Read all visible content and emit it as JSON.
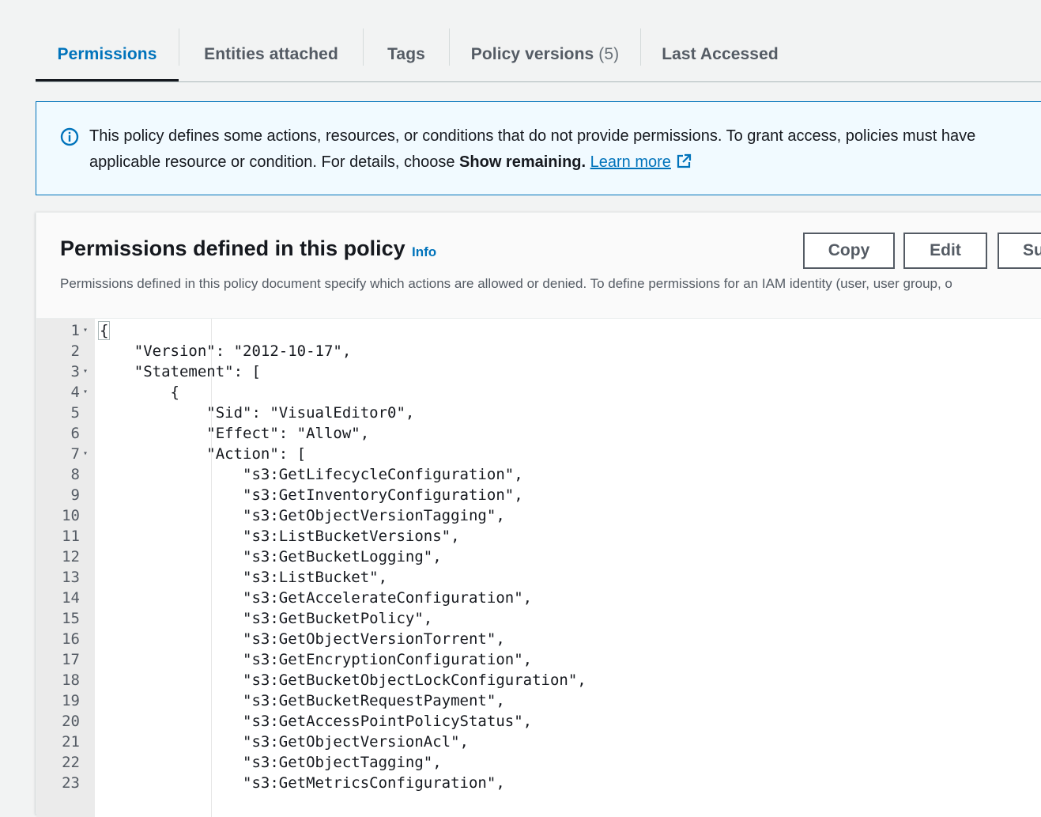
{
  "tabs": [
    {
      "label": "Permissions",
      "count": "",
      "active": true
    },
    {
      "label": "Entities attached",
      "count": "",
      "active": false
    },
    {
      "label": "Tags",
      "count": "",
      "active": false
    },
    {
      "label": "Policy versions",
      "count": "(5)",
      "active": false
    },
    {
      "label": "Last Accessed",
      "count": "",
      "active": false
    }
  ],
  "alert": {
    "icon": "info-icon",
    "text_part1": "This policy defines some actions, resources, or conditions that do not provide permissions. To grant access, policies must have",
    "text_part2": "applicable resource or condition. For details, choose ",
    "bold": "Show remaining.",
    "link": "Learn more",
    "link_icon": "external-link-icon"
  },
  "panel": {
    "title": "Permissions defined in this policy",
    "info": "Info",
    "buttons": {
      "copy": "Copy",
      "edit": "Edit",
      "third": "Su"
    },
    "description": "Permissions defined in this policy document specify which actions are allowed or denied. To define permissions for an IAM identity (user, user group, o"
  },
  "editor": {
    "lines": [
      {
        "n": "1",
        "fold": true,
        "text": "{"
      },
      {
        "n": "2",
        "fold": false,
        "text": "    \"Version\": \"2012-10-17\","
      },
      {
        "n": "3",
        "fold": true,
        "text": "    \"Statement\": ["
      },
      {
        "n": "4",
        "fold": true,
        "text": "        {"
      },
      {
        "n": "5",
        "fold": false,
        "text": "            \"Sid\": \"VisualEditor0\","
      },
      {
        "n": "6",
        "fold": false,
        "text": "            \"Effect\": \"Allow\","
      },
      {
        "n": "7",
        "fold": true,
        "text": "            \"Action\": ["
      },
      {
        "n": "8",
        "fold": false,
        "text": "                \"s3:GetLifecycleConfiguration\","
      },
      {
        "n": "9",
        "fold": false,
        "text": "                \"s3:GetInventoryConfiguration\","
      },
      {
        "n": "10",
        "fold": false,
        "text": "                \"s3:GetObjectVersionTagging\","
      },
      {
        "n": "11",
        "fold": false,
        "text": "                \"s3:ListBucketVersions\","
      },
      {
        "n": "12",
        "fold": false,
        "text": "                \"s3:GetBucketLogging\","
      },
      {
        "n": "13",
        "fold": false,
        "text": "                \"s3:ListBucket\","
      },
      {
        "n": "14",
        "fold": false,
        "text": "                \"s3:GetAccelerateConfiguration\","
      },
      {
        "n": "15",
        "fold": false,
        "text": "                \"s3:GetBucketPolicy\","
      },
      {
        "n": "16",
        "fold": false,
        "text": "                \"s3:GetObjectVersionTorrent\","
      },
      {
        "n": "17",
        "fold": false,
        "text": "                \"s3:GetEncryptionConfiguration\","
      },
      {
        "n": "18",
        "fold": false,
        "text": "                \"s3:GetBucketObjectLockConfiguration\","
      },
      {
        "n": "19",
        "fold": false,
        "text": "                \"s3:GetBucketRequestPayment\","
      },
      {
        "n": "20",
        "fold": false,
        "text": "                \"s3:GetAccessPointPolicyStatus\","
      },
      {
        "n": "21",
        "fold": false,
        "text": "                \"s3:GetObjectVersionAcl\","
      },
      {
        "n": "22",
        "fold": false,
        "text": "                \"s3:GetObjectTagging\","
      },
      {
        "n": "23",
        "fold": false,
        "text": "                \"s3:GetMetricsConfiguration\","
      }
    ]
  },
  "colors": {
    "accent": "#0073bb",
    "alert_bg": "#f1faff",
    "text": "#16191f"
  }
}
